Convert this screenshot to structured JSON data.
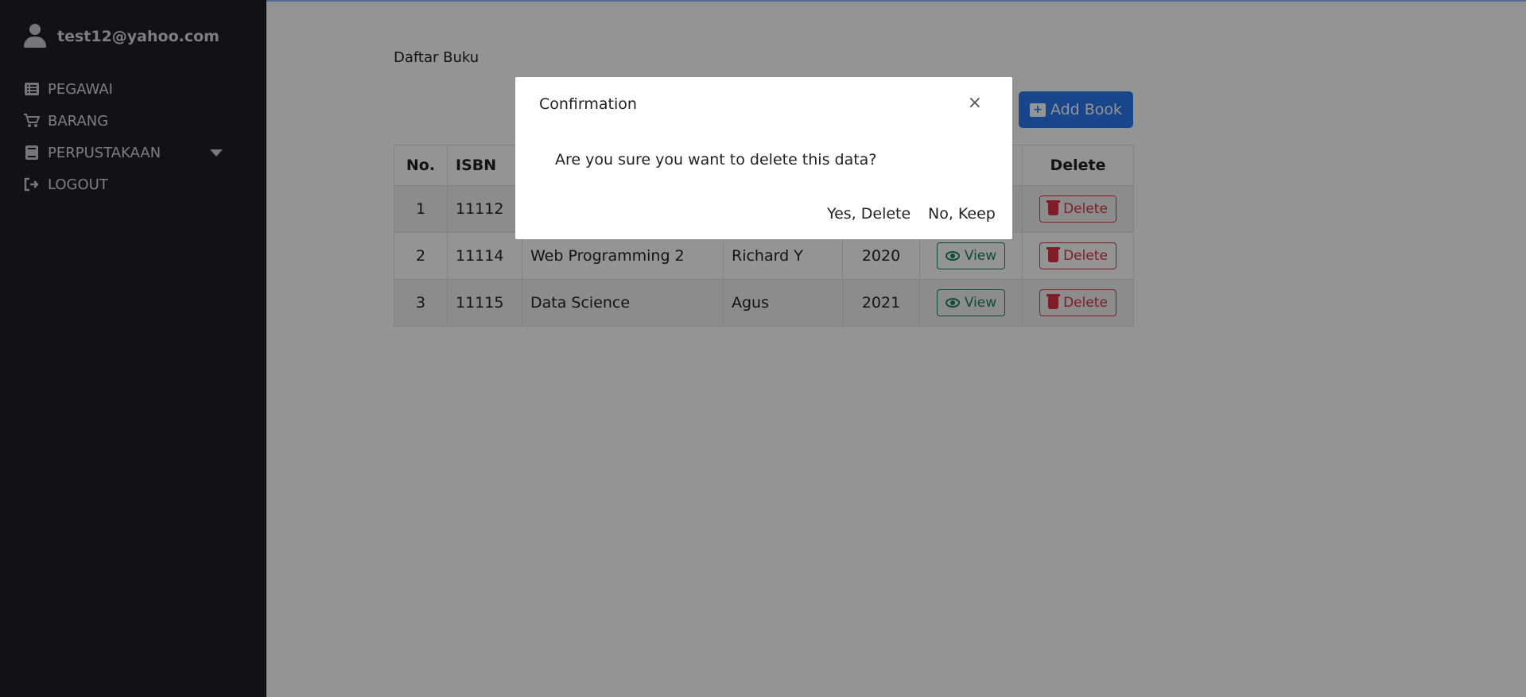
{
  "user": {
    "email": "test12@yahoo.com",
    "icon": "user-icon"
  },
  "nav": [
    {
      "label": "PEGAWAI",
      "icon": "list-icon"
    },
    {
      "label": "BARANG",
      "icon": "cart-icon"
    },
    {
      "label": "PERPUSTAKAAN",
      "icon": "book-icon"
    },
    {
      "label": "LOGOUT",
      "icon": "logout-icon"
    }
  ],
  "main": {
    "title": "Daftar Buku",
    "add_label": "Add Book"
  },
  "table": {
    "headers": [
      "No.",
      "ISBN",
      "",
      "",
      "",
      "",
      "Delete"
    ],
    "rows": [
      {
        "no": "1",
        "isbn": "11112",
        "title": "",
        "author": "",
        "year": "",
        "view": "",
        "delete": "Delete"
      },
      {
        "no": "2",
        "isbn": "11114",
        "title": "Web Programming 2",
        "author": "Richard Y",
        "year": "2020",
        "view": "View",
        "delete": "Delete"
      },
      {
        "no": "3",
        "isbn": "11115",
        "title": "Data Science",
        "author": "Agus",
        "year": "2021",
        "view": "View",
        "delete": "Delete"
      }
    ]
  },
  "modal": {
    "title": "Confirmation",
    "close": "×",
    "message": "Are you sure you want to delete this data?",
    "yes": "Yes, Delete",
    "no": "No, Keep"
  },
  "colors": {
    "sidebar_bg": "#1d2029",
    "primary": "#2c79ee",
    "success": "#198754",
    "danger": "#dc3545"
  }
}
